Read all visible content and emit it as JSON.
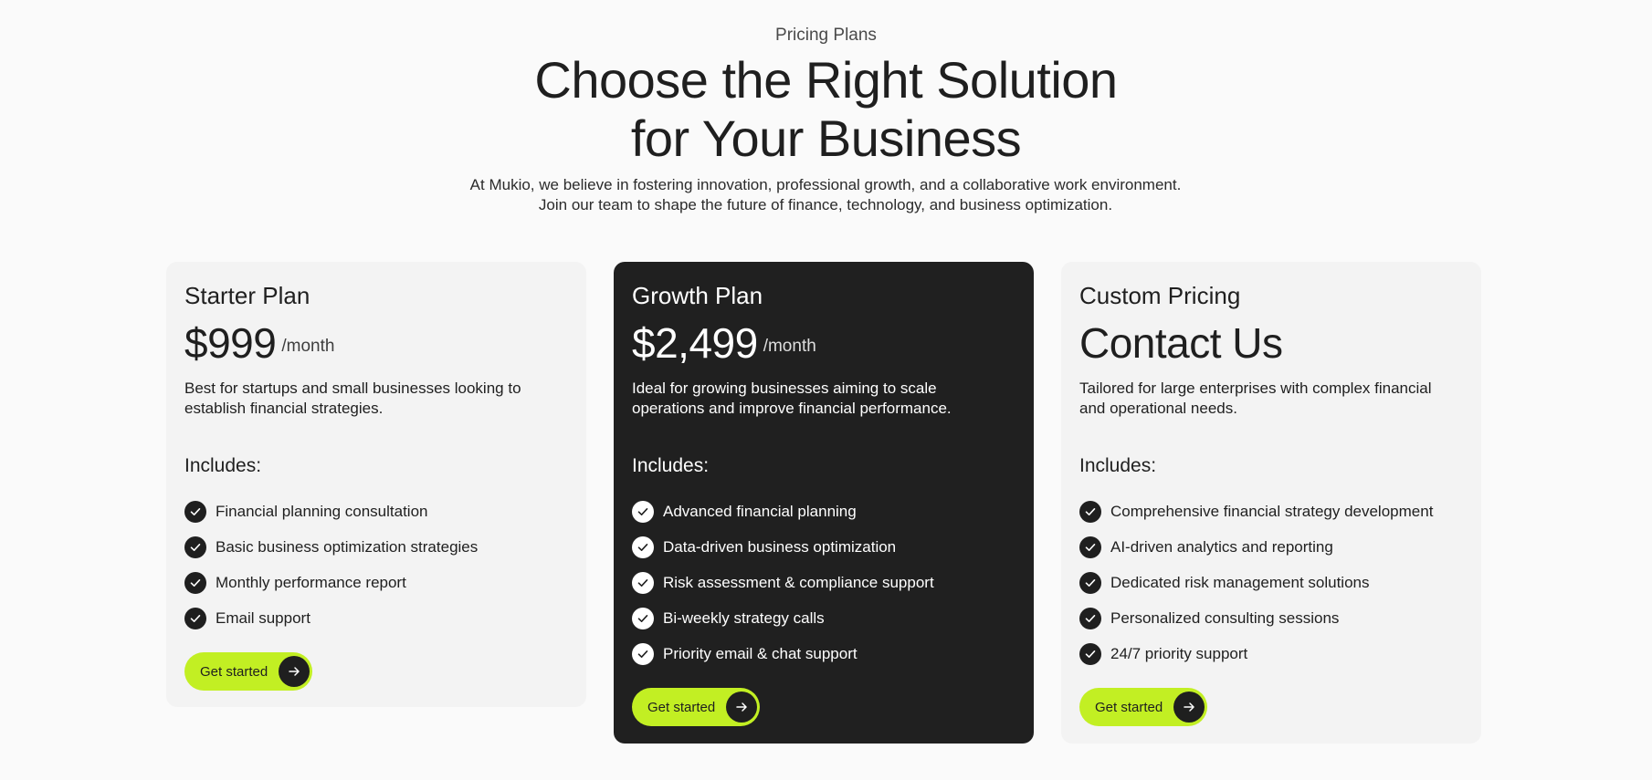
{
  "header": {
    "eyebrow": "Pricing Plans",
    "title_line1": "Choose the Right Solution",
    "title_line2": "for Your Business",
    "subtitle": "At Mukio, we believe in fostering innovation, professional growth, and a collaborative work environment. Join our team to shape the future of finance, technology, and business optimization."
  },
  "colors": {
    "accent": "#c2ef23",
    "dark_card": "#202020",
    "light_card": "#f3f3f3",
    "page_bg": "#fafafa"
  },
  "plans": [
    {
      "name": "Starter Plan",
      "price": "$999",
      "period": "/month",
      "description": "Best for startups and small businesses looking to establish financial strategies.",
      "includes_label": "Includes:",
      "features": [
        "Financial planning consultation",
        "Basic business optimization strategies",
        "Monthly performance report",
        "Email support"
      ],
      "cta_label": "Get started",
      "cta_icon": "arrow-right-icon",
      "feature_icon": "check-circle-icon"
    },
    {
      "name": "Growth Plan",
      "price": "$2,499",
      "period": "/month",
      "description": "Ideal for growing businesses aiming to scale operations and improve financial performance.",
      "includes_label": "Includes:",
      "features": [
        "Advanced financial planning",
        "Data-driven business optimization",
        "Risk assessment & compliance support",
        "Bi-weekly strategy calls",
        "Priority email & chat support"
      ],
      "cta_label": "Get started",
      "cta_icon": "arrow-right-icon",
      "feature_icon": "check-circle-icon"
    },
    {
      "name": "Custom Pricing",
      "price": "Contact Us",
      "period": "",
      "description": "Tailored for large enterprises with complex financial and operational needs.",
      "includes_label": "Includes:",
      "features": [
        "Comprehensive financial strategy development",
        "AI-driven analytics and reporting",
        "Dedicated risk management solutions",
        "Personalized consulting sessions",
        "24/7 priority support"
      ],
      "cta_label": "Get started",
      "cta_icon": "arrow-right-icon",
      "feature_icon": "check-circle-icon"
    }
  ]
}
